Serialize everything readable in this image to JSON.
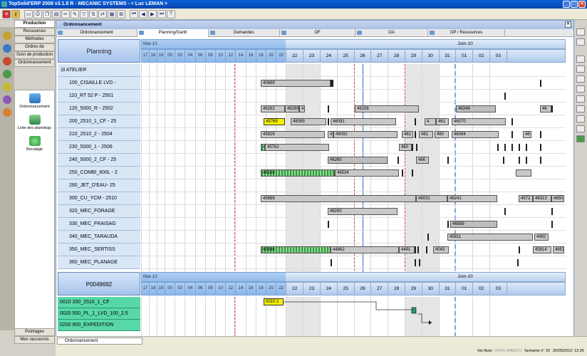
{
  "window": {
    "title": "TopSolid'ERP 2008   v3.1.8 R  -  MECANIC SYSTEMS  - < Luc LEMAN >"
  },
  "sidebar": {
    "tabs": [
      "Production",
      "Ressources",
      "Méthodes",
      "Ordres de fabrication",
      "Suivi de production",
      "Ordonnancement"
    ],
    "active": "Production",
    "items": [
      {
        "label": "Ordonnancement"
      },
      {
        "label": "Liste des plannings"
      },
      {
        "label": "Recalage"
      }
    ],
    "bottom": [
      "Pointages",
      "Mes raccourcis"
    ]
  },
  "panel": {
    "title": "Ordonnancement",
    "tabs": [
      "Ordonnancement",
      "Planning/Gantt",
      "Demandes",
      "OF",
      "OA",
      "OP / Ressources"
    ]
  },
  "gantt": {
    "header_label": "Planning",
    "month_left": "Mai-10",
    "month_right": "Juin-10",
    "small_days": [
      "17",
      "18",
      "19"
    ],
    "hours": [
      "00",
      "02",
      "04",
      "06",
      "08",
      "10",
      "12",
      "14",
      "16",
      "18",
      "20",
      "22"
    ],
    "big_days": [
      "22",
      "23",
      "24",
      "25",
      "26",
      "27",
      "28",
      "29",
      "30",
      "31",
      "01",
      "02",
      "03"
    ],
    "group": "ATELIER",
    "rows": [
      {
        "label": "100_CISAILLE LVD -",
        "bars": [
          "40669"
        ]
      },
      {
        "label": "110_RT 52 P - 2501",
        "bars": []
      },
      {
        "label": "120_5000_R - 2502",
        "bars": [
          "46262",
          "46289",
          "4",
          "46156",
          "46348",
          "46"
        ]
      },
      {
        "label": "200_2510_1_CF - 25",
        "bars": [
          "45769",
          "46099",
          "46091",
          "4",
          "461",
          "46070"
        ]
      },
      {
        "label": "210_2510_2 - 2504",
        "bars": [
          "45829",
          "4",
          "46092",
          "461",
          "461",
          "460",
          "46084",
          "46"
        ]
      },
      {
        "label": "230_5000_1 - 2506",
        "bars": [
          "4",
          "45762",
          "460"
        ]
      },
      {
        "label": "240_5000_2_CF - 25",
        "bars": [
          "46260",
          "466"
        ]
      },
      {
        "label": "250_COMBI_600L - 2",
        "bars": [
          "46168",
          "46534"
        ]
      },
      {
        "label": "260_JET_D'EAU- 25",
        "bars": []
      },
      {
        "label": "300_CU_YCM - 2510",
        "bars": [
          "45688",
          "46031",
          "46241",
          "4572",
          "46313",
          "4650"
        ]
      },
      {
        "label": "320_MEC_FORAGE",
        "bars": [
          "46290"
        ]
      },
      {
        "label": "330_MEC_FRAISAG",
        "bars": [
          "46589"
        ]
      },
      {
        "label": "340_MEC_TARAUDA",
        "bars": [
          "45811",
          "4482"
        ]
      },
      {
        "label": "350_MEC_SERTISS",
        "bars": [
          "45686",
          "44862",
          "4491",
          "4043",
          "45614",
          "4653"
        ]
      },
      {
        "label": "360_MEC_PLANAGE",
        "bars": []
      }
    ]
  },
  "of_gantt": {
    "header_label": "P0049692",
    "rows": [
      "0010 200_2510_1_CF",
      "0020 500_PL_1_LVD_100_2.5",
      "0200 900_EXPEDITION"
    ],
    "marker": "0010 2"
  },
  "status": {
    "tab": "Ordonnancement",
    "ver": "Ver.Num",
    "verr": "VERR.MAJ",
    "defil": "DEFIL",
    "week": "Semaine n° 20",
    "date": "20/05/2010",
    "time": "13:36"
  }
}
